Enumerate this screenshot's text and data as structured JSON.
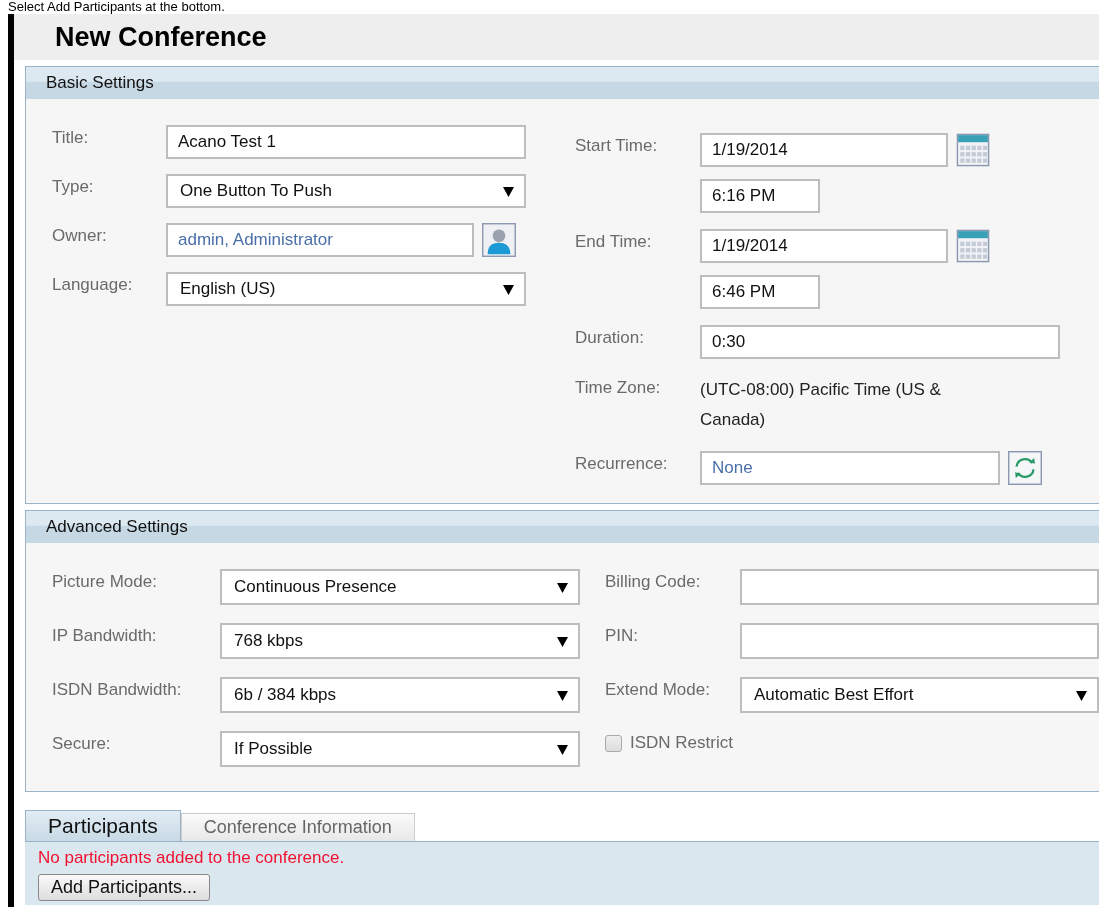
{
  "caption": "Select Add Participants at the bottom.",
  "page_title": "New Conference",
  "basic_settings": {
    "heading": "Basic Settings",
    "left_fields": [
      {
        "label": "Title:",
        "kind": "text",
        "value": "Acano Test 1"
      },
      {
        "label": "Type:",
        "kind": "select",
        "value": "One Button To Push"
      },
      {
        "label": "Owner:",
        "kind": "lookup",
        "value": "admin, Administrator"
      },
      {
        "label": "Language:",
        "kind": "select",
        "value": "English (US)"
      }
    ],
    "right_fields": [
      {
        "label": "Start Time:",
        "kind": "datetime",
        "date": "1/19/2014",
        "time": "6:16 PM"
      },
      {
        "label": "End Time:",
        "kind": "datetime",
        "date": "1/19/2014",
        "time": "6:46 PM"
      },
      {
        "label": "Duration:",
        "kind": "text",
        "value": "0:30"
      },
      {
        "label": "Time Zone:",
        "kind": "static",
        "value": "(UTC-08:00) Pacific Time (US & Canada)"
      },
      {
        "label": "Recurrence:",
        "kind": "recurrence",
        "value": "None"
      }
    ]
  },
  "advanced_settings": {
    "heading": "Advanced Settings",
    "left_fields": [
      {
        "label": "Picture Mode:",
        "kind": "select",
        "value": "Continuous Presence"
      },
      {
        "label": "IP Bandwidth:",
        "kind": "select",
        "value": "768 kbps"
      },
      {
        "label": "ISDN Bandwidth:",
        "kind": "select",
        "value": "6b / 384 kbps"
      },
      {
        "label": "Secure:",
        "kind": "select",
        "value": "If Possible"
      }
    ],
    "right_fields": [
      {
        "label": "Billing Code:",
        "kind": "text"
      },
      {
        "label": "PIN:",
        "kind": "text"
      },
      {
        "label": "Extend Mode:",
        "kind": "select",
        "value": "Automatic Best Effort"
      },
      {
        "label": "ISDN Restrict",
        "kind": "checkbox",
        "checked": false
      }
    ]
  },
  "tabs": [
    {
      "label": "Participants",
      "selected": true
    },
    {
      "label": "Conference Information",
      "selected": false
    }
  ],
  "message": "No participants added to the conference.",
  "add_button": "Add Participants..."
}
